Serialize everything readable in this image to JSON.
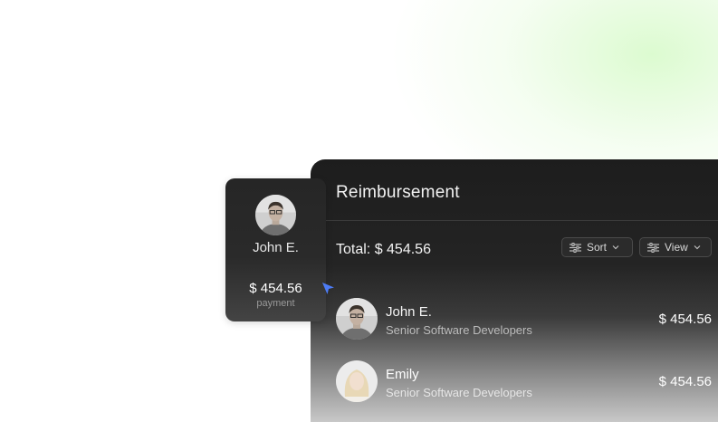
{
  "panel": {
    "title": "Reimbursement",
    "total_label": "Total: $ 454.56",
    "sort_label": "Sort",
    "view_label": "View"
  },
  "rows": [
    {
      "name": "John E.",
      "role": "Senior Software Developers",
      "amount": "$ 454.56"
    },
    {
      "name": "Emily",
      "role": "Senior Software Developers",
      "amount": "$ 454.56"
    }
  ],
  "drag_card": {
    "name": "John E.",
    "amount": "$ 454.56",
    "note": "payment"
  },
  "colors": {
    "panel_bg": "#1d1d1d",
    "cursor": "#4d7cf5",
    "glow": "#d6fac8"
  },
  "icons": {
    "sort": "sliders-icon",
    "view": "sliders-icon",
    "chevron": "chevron-down-icon",
    "cursor": "pointer-cursor-icon"
  }
}
